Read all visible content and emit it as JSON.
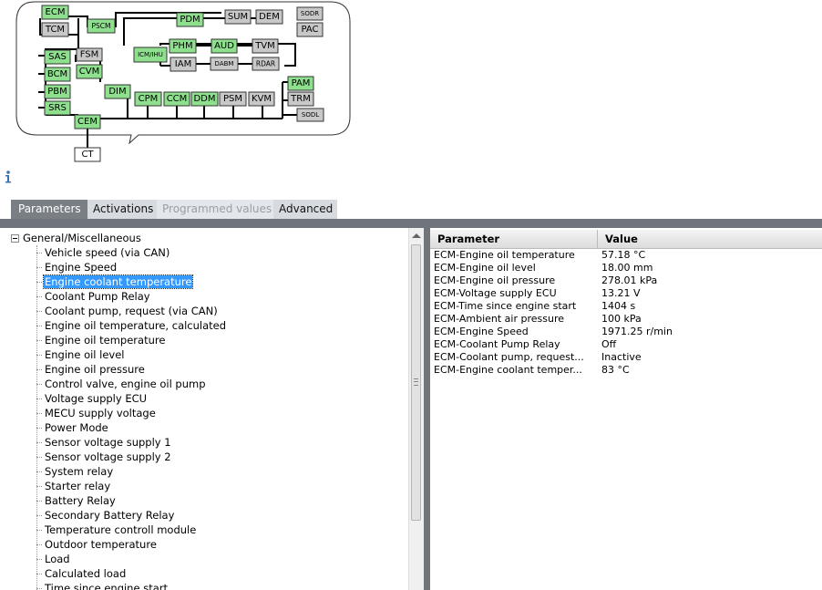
{
  "topology": {
    "nodes": [
      {
        "label": "ECM",
        "color": "#8ee08e"
      },
      {
        "label": "TCM",
        "color": "#c8c8c8"
      },
      {
        "label": "PSCM",
        "color": "#8ee08e"
      },
      {
        "label": "PDM",
        "color": "#8ee08e"
      },
      {
        "label": "SUM",
        "color": "#c8c8c8"
      },
      {
        "label": "DEM",
        "color": "#c8c8c8"
      },
      {
        "label": "SODR",
        "color": "#c8c8c8"
      },
      {
        "label": "PAC",
        "color": "#c8c8c8"
      },
      {
        "label": "ICM/IHU",
        "color": "#8ee08e"
      },
      {
        "label": "PHM",
        "color": "#8ee08e"
      },
      {
        "label": "AUD",
        "color": "#8ee08e"
      },
      {
        "label": "TVM",
        "color": "#c8c8c8"
      },
      {
        "label": "IAM",
        "color": "#c8c8c8"
      },
      {
        "label": "DABM",
        "color": "#c8c8c8"
      },
      {
        "label": "RDAR",
        "color": "#c8c8c8"
      },
      {
        "label": "SAS",
        "color": "#8ee08e"
      },
      {
        "label": "FSM",
        "color": "#c8c8c8"
      },
      {
        "label": "BCM",
        "color": "#8ee08e"
      },
      {
        "label": "CVM",
        "color": "#8ee08e"
      },
      {
        "label": "PBM",
        "color": "#8ee08e"
      },
      {
        "label": "DIM",
        "color": "#8ee08e"
      },
      {
        "label": "SRS",
        "color": "#8ee08e"
      },
      {
        "label": "CPM",
        "color": "#8ee08e"
      },
      {
        "label": "CCM",
        "color": "#8ee08e"
      },
      {
        "label": "DDM",
        "color": "#8ee08e"
      },
      {
        "label": "PSM",
        "color": "#c8c8c8"
      },
      {
        "label": "KVM",
        "color": "#c8c8c8"
      },
      {
        "label": "PAM",
        "color": "#8ee08e"
      },
      {
        "label": "TRM",
        "color": "#c8c8c8"
      },
      {
        "label": "SODL",
        "color": "#c8c8c8"
      },
      {
        "label": "CEM",
        "color": "#8ee08e"
      },
      {
        "label": "CT",
        "color": "#ffffff"
      }
    ]
  },
  "tabs": [
    {
      "label": "Parameters",
      "state": "active"
    },
    {
      "label": "Activations",
      "state": "normal"
    },
    {
      "label": "Programmed values",
      "state": "disabled"
    },
    {
      "label": "Advanced",
      "state": "normal"
    }
  ],
  "tree": {
    "root": "General/Miscellaneous",
    "selected_index": 2,
    "items": [
      "Vehicle speed (via CAN)",
      "Engine Speed",
      "Engine coolant temperature",
      "Coolant Pump Relay",
      "Coolant pump, request (via CAN)",
      "Engine oil temperature, calculated",
      "Engine oil temperature",
      "Engine oil level",
      "Engine oil pressure",
      "Control valve, engine oil pump",
      "Voltage supply ECU",
      "MECU supply voltage",
      "Power Mode",
      "Sensor voltage supply 1",
      "Sensor voltage supply 2",
      "System relay",
      "Starter relay",
      "Battery Relay",
      "Secondary Battery Relay",
      "Temperature controll module",
      "Outdoor temperature",
      "Load",
      "Calculated load",
      "Time since engine start"
    ]
  },
  "grid": {
    "columns": [
      "Parameter",
      "Value"
    ],
    "rows": [
      {
        "parameter": "ECM-Engine oil temperature",
        "value": "57.18 °C"
      },
      {
        "parameter": "ECM-Engine oil level",
        "value": "18.00 mm"
      },
      {
        "parameter": "ECM-Engine oil pressure",
        "value": "278.01 kPa"
      },
      {
        "parameter": "ECM-Voltage supply ECU",
        "value": "13.21 V"
      },
      {
        "parameter": "ECM-Time since engine start",
        "value": "1404 s"
      },
      {
        "parameter": "ECM-Ambient air pressure",
        "value": "100 kPa"
      },
      {
        "parameter": "ECM-Engine Speed",
        "value": "1971.25 r/min"
      },
      {
        "parameter": "ECM-Coolant Pump Relay",
        "value": "Off"
      },
      {
        "parameter": "ECM-Coolant pump, request...",
        "value": "Inactive"
      },
      {
        "parameter": "ECM-Engine coolant temper...",
        "value": "83 °C"
      }
    ]
  }
}
